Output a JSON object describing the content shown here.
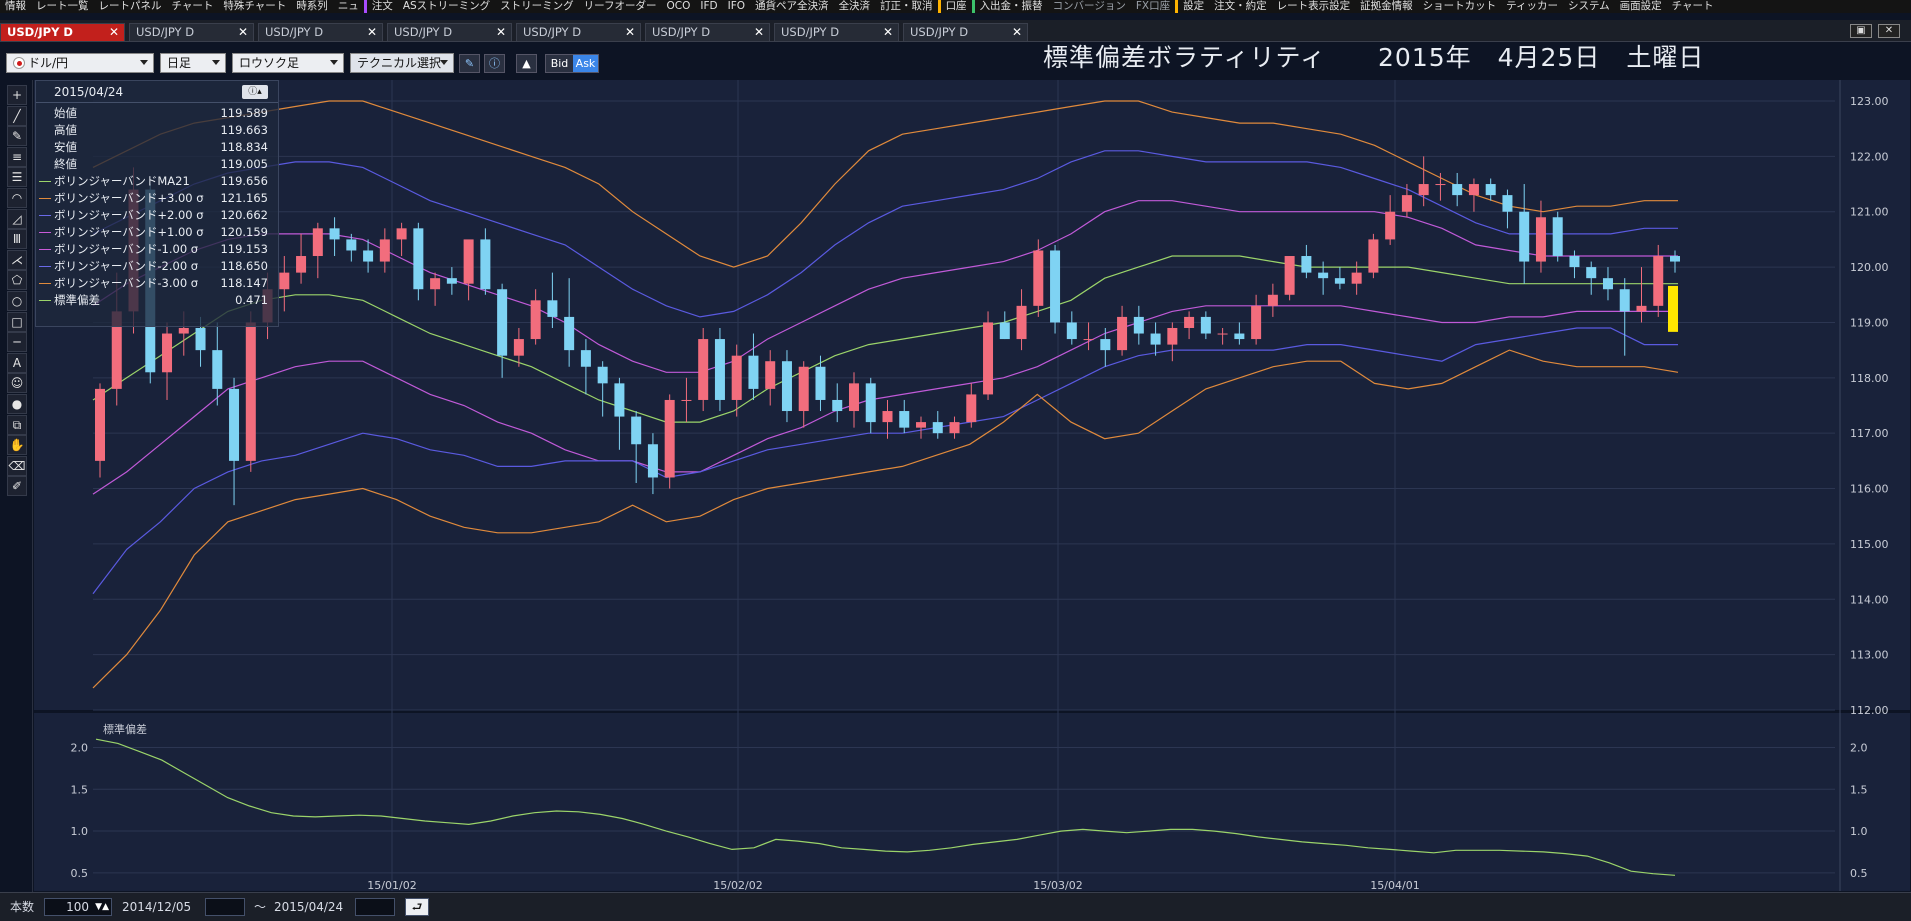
{
  "menubar": {
    "items": [
      "情報",
      "レート一覧",
      "レートパネル",
      "チャート",
      "特殊チャート",
      "時系列",
      "ニュ",
      "注文",
      "ASストリーミング",
      "ストリーミング",
      "リーフオーダー",
      "OCO",
      "IFD",
      "IFO",
      "通貨ペア全決済",
      "全決済",
      "訂正・取消",
      "口座",
      "入出金・振替",
      "コンバージョン",
      "FX口座",
      "設定",
      "注文・約定",
      "レート表示設定",
      "証拠金情報",
      "ショートカット",
      "ティッカー",
      "システム",
      "画面設定",
      "チャート"
    ]
  },
  "tabs": [
    {
      "label": "USD/JPY D",
      "active": true
    },
    {
      "label": "USD/JPY D",
      "active": false
    },
    {
      "label": "USD/JPY D",
      "active": false
    },
    {
      "label": "USD/JPY D",
      "active": false
    },
    {
      "label": "USD/JPY D",
      "active": false
    },
    {
      "label": "USD/JPY D",
      "active": false
    },
    {
      "label": "USD/JPY D",
      "active": false
    },
    {
      "label": "USD/JPY D",
      "active": false
    }
  ],
  "toolbar": {
    "pair": "ドル/円",
    "period": "日足",
    "chart_type": "ロウソク足",
    "technical": "テクニカル選択",
    "bid": "Bid",
    "ask": "Ask"
  },
  "title": "標準偏差ボラティリティ　　2015年　4月25日　土曜日",
  "info": {
    "date": "2015/04/24",
    "rows": [
      {
        "label": "始値",
        "value": "119.589",
        "color": ""
      },
      {
        "label": "高値",
        "value": "119.663",
        "color": ""
      },
      {
        "label": "安値",
        "value": "118.834",
        "color": ""
      },
      {
        "label": "終値",
        "value": "119.005",
        "color": ""
      },
      {
        "label": "ボリンジャーバンドMA21",
        "value": "119.656",
        "color": "#9bd46a"
      },
      {
        "label": "ボリンジャーバンド+3.00 σ",
        "value": "121.165",
        "color": "#e08a3c"
      },
      {
        "label": "ボリンジャーバンド+2.00 σ",
        "value": "120.662",
        "color": "#6a6ae8"
      },
      {
        "label": "ボリンジャーバンド+1.00 σ",
        "value": "120.159",
        "color": "#c85ad8"
      },
      {
        "label": "ボリンジャーバンド-1.00 σ",
        "value": "119.153",
        "color": "#c85ad8"
      },
      {
        "label": "ボリンジャーバンド-2.00 σ",
        "value": "118.650",
        "color": "#6a6ae8"
      },
      {
        "label": "ボリンジャーバンド-3.00 σ",
        "value": "118.147",
        "color": "#e08a3c"
      },
      {
        "label": "標準偏差",
        "value": "0.471",
        "color": "#9bd46a"
      }
    ]
  },
  "footer": {
    "count_label": "本数",
    "count": "100",
    "from_date": "2014/12/05",
    "tilde": "〜",
    "to_date": "2015/04/24"
  },
  "chart_data": [
    {
      "type": "candlestick",
      "title": "",
      "y_ticks": [
        "123.00",
        "122.00",
        "121.00",
        "120.00",
        "119.00",
        "118.00",
        "117.00",
        "116.00",
        "115.00",
        "114.00",
        "113.00",
        "112.00"
      ],
      "ylim": [
        112.0,
        123.0
      ],
      "x_tick_labels": [
        "15/01/02",
        "15/02/02",
        "15/03/02",
        "15/04/01"
      ],
      "candles": [
        [
          116.5,
          117.9,
          116.2,
          117.8
        ],
        [
          117.8,
          119.9,
          117.5,
          119.2
        ],
        [
          119.2,
          121.8,
          118.8,
          121.4
        ],
        [
          121.4,
          121.5,
          117.9,
          118.1
        ],
        [
          118.1,
          119.0,
          117.6,
          118.8
        ],
        [
          118.8,
          119.2,
          118.4,
          118.9
        ],
        [
          118.9,
          119.1,
          118.2,
          118.5
        ],
        [
          118.5,
          119.0,
          117.5,
          117.8
        ],
        [
          117.8,
          118.0,
          115.7,
          116.5
        ],
        [
          116.5,
          119.2,
          116.3,
          119.0
        ],
        [
          119.0,
          119.9,
          118.7,
          119.6
        ],
        [
          119.6,
          120.2,
          119.2,
          119.9
        ],
        [
          119.9,
          120.6,
          119.7,
          120.2
        ],
        [
          120.2,
          120.8,
          119.8,
          120.7
        ],
        [
          120.7,
          120.9,
          120.2,
          120.5
        ],
        [
          120.5,
          120.6,
          120.1,
          120.3
        ],
        [
          120.3,
          120.5,
          119.9,
          120.1
        ],
        [
          120.1,
          120.7,
          119.9,
          120.5
        ],
        [
          120.5,
          120.8,
          120.2,
          120.7
        ],
        [
          120.7,
          120.8,
          119.4,
          119.6
        ],
        [
          119.6,
          119.9,
          119.3,
          119.8
        ],
        [
          119.8,
          120.0,
          119.5,
          119.7
        ],
        [
          119.7,
          120.3,
          119.4,
          120.5
        ],
        [
          120.5,
          120.7,
          119.5,
          119.6
        ],
        [
          119.6,
          119.7,
          118.0,
          118.4
        ],
        [
          118.4,
          118.9,
          118.2,
          118.7
        ],
        [
          118.7,
          119.6,
          118.6,
          119.4
        ],
        [
          119.4,
          119.9,
          118.9,
          119.1
        ],
        [
          119.1,
          119.8,
          118.2,
          118.5
        ],
        [
          118.5,
          118.7,
          117.7,
          118.2
        ],
        [
          118.2,
          118.3,
          117.3,
          117.9
        ],
        [
          117.9,
          118.0,
          116.7,
          117.3
        ],
        [
          117.3,
          117.4,
          116.1,
          116.8
        ],
        [
          116.8,
          117.0,
          115.9,
          116.2
        ],
        [
          116.2,
          117.7,
          116.0,
          117.6
        ],
        [
          117.6,
          118.0,
          117.2,
          117.6
        ],
        [
          117.6,
          118.9,
          117.4,
          118.7
        ],
        [
          118.7,
          118.9,
          117.4,
          117.6
        ],
        [
          117.6,
          118.6,
          117.3,
          118.4
        ],
        [
          118.4,
          118.8,
          117.6,
          117.8
        ],
        [
          117.8,
          118.5,
          117.5,
          118.3
        ],
        [
          118.3,
          118.5,
          117.2,
          117.4
        ],
        [
          117.4,
          118.3,
          117.1,
          118.2
        ],
        [
          118.2,
          118.4,
          117.4,
          117.6
        ],
        [
          117.6,
          117.9,
          117.2,
          117.4
        ],
        [
          117.4,
          118.1,
          117.1,
          117.9
        ],
        [
          117.9,
          118.0,
          117.0,
          117.2
        ],
        [
          117.2,
          117.6,
          116.9,
          117.4
        ],
        [
          117.4,
          117.6,
          117.0,
          117.1
        ],
        [
          117.1,
          117.3,
          116.9,
          117.2
        ],
        [
          117.2,
          117.4,
          116.9,
          117.0
        ],
        [
          117.0,
          117.3,
          116.9,
          117.2
        ],
        [
          117.2,
          117.9,
          117.1,
          117.7
        ],
        [
          117.7,
          119.2,
          117.6,
          119.0
        ],
        [
          119.0,
          119.2,
          118.7,
          118.7
        ],
        [
          118.7,
          119.6,
          118.5,
          119.3
        ],
        [
          119.3,
          120.5,
          119.1,
          120.3
        ],
        [
          120.3,
          120.4,
          118.8,
          119.0
        ],
        [
          119.0,
          119.2,
          118.6,
          118.7
        ],
        [
          118.7,
          119.0,
          118.5,
          118.7
        ],
        [
          118.7,
          118.9,
          118.2,
          118.5
        ],
        [
          118.5,
          119.3,
          118.4,
          119.1
        ],
        [
          119.1,
          119.3,
          118.6,
          118.8
        ],
        [
          118.8,
          119.0,
          118.4,
          118.6
        ],
        [
          118.6,
          119.0,
          118.3,
          118.9
        ],
        [
          118.9,
          119.2,
          118.7,
          119.1
        ],
        [
          119.1,
          119.2,
          118.7,
          118.8
        ],
        [
          118.8,
          118.9,
          118.6,
          118.8
        ],
        [
          118.8,
          119.0,
          118.6,
          118.7
        ],
        [
          118.7,
          119.5,
          118.6,
          119.3
        ],
        [
          119.3,
          119.7,
          119.1,
          119.5
        ],
        [
          119.5,
          120.2,
          119.4,
          120.2
        ],
        [
          120.2,
          120.4,
          119.8,
          119.9
        ],
        [
          119.9,
          120.1,
          119.5,
          119.8
        ],
        [
          119.8,
          120.0,
          119.6,
          119.7
        ],
        [
          119.7,
          120.1,
          119.5,
          119.9
        ],
        [
          119.9,
          120.6,
          119.8,
          120.5
        ],
        [
          120.5,
          121.3,
          120.4,
          121.0
        ],
        [
          121.0,
          121.5,
          120.9,
          121.3
        ],
        [
          121.3,
          122.0,
          121.1,
          121.5
        ],
        [
          121.5,
          121.7,
          121.2,
          121.5
        ],
        [
          121.5,
          121.7,
          121.1,
          121.3
        ],
        [
          121.3,
          121.6,
          121.0,
          121.5
        ],
        [
          121.5,
          121.6,
          121.2,
          121.3
        ],
        [
          121.3,
          121.4,
          120.7,
          121.0
        ],
        [
          121.0,
          121.5,
          119.7,
          120.1
        ],
        [
          120.1,
          121.2,
          119.9,
          120.9
        ],
        [
          120.9,
          121.0,
          120.1,
          120.2
        ],
        [
          120.2,
          120.3,
          119.8,
          120.0
        ],
        [
          120.0,
          120.1,
          119.5,
          119.8
        ],
        [
          119.8,
          120.0,
          119.4,
          119.6
        ],
        [
          119.6,
          119.8,
          118.4,
          119.2
        ],
        [
          119.2,
          120.0,
          119.0,
          119.3
        ],
        [
          119.3,
          120.4,
          119.1,
          120.2
        ],
        [
          120.2,
          120.3,
          119.9,
          120.1
        ]
      ],
      "bands": {
        "upper3": [
          121.8,
          122.1,
          122.4,
          122.6,
          122.7,
          122.8,
          122.9,
          123.0,
          123.0,
          122.8,
          122.6,
          122.4,
          122.2,
          122.0,
          121.8,
          121.5,
          121.0,
          120.6,
          120.2,
          120.0,
          120.2,
          120.8,
          121.5,
          122.1,
          122.4,
          122.5,
          122.6,
          122.7,
          122.8,
          122.9,
          123.0,
          123.0,
          122.8,
          122.7,
          122.6,
          122.6,
          122.5,
          122.4,
          122.2,
          121.9,
          121.6,
          121.3,
          121.1,
          121.0,
          121.1,
          121.1,
          121.2,
          121.2
        ],
        "upper2": [
          120.6,
          120.9,
          121.2,
          121.5,
          121.7,
          121.8,
          121.9,
          121.9,
          121.8,
          121.5,
          121.2,
          121.0,
          120.8,
          120.6,
          120.4,
          120.0,
          119.6,
          119.3,
          119.1,
          119.2,
          119.5,
          119.9,
          120.4,
          120.8,
          121.1,
          121.2,
          121.3,
          121.4,
          121.6,
          121.9,
          122.1,
          122.1,
          122.0,
          121.9,
          121.9,
          121.9,
          121.9,
          121.8,
          121.6,
          121.4,
          121.1,
          120.8,
          120.6,
          120.6,
          120.6,
          120.6,
          120.7,
          120.7
        ],
        "upper1": [
          119.3,
          119.7,
          120.0,
          120.3,
          120.5,
          120.6,
          120.6,
          120.6,
          120.5,
          120.2,
          119.9,
          119.7,
          119.5,
          119.3,
          119.0,
          118.6,
          118.3,
          118.1,
          118.1,
          118.3,
          118.7,
          119.0,
          119.3,
          119.6,
          119.8,
          119.9,
          120.0,
          120.1,
          120.3,
          120.6,
          121.0,
          121.2,
          121.2,
          121.1,
          121.0,
          121.0,
          121.0,
          121.0,
          121.0,
          120.9,
          120.7,
          120.4,
          120.3,
          120.2,
          120.2,
          120.2,
          120.2,
          120.2
        ],
        "ma": [
          117.6,
          118.0,
          118.4,
          118.8,
          119.2,
          119.4,
          119.5,
          119.5,
          119.4,
          119.1,
          118.8,
          118.6,
          118.4,
          118.2,
          117.9,
          117.6,
          117.4,
          117.2,
          117.2,
          117.4,
          117.8,
          118.1,
          118.4,
          118.6,
          118.7,
          118.8,
          118.9,
          119.0,
          119.2,
          119.4,
          119.8,
          120.0,
          120.2,
          120.2,
          120.2,
          120.1,
          120.0,
          120.0,
          120.0,
          120.0,
          119.9,
          119.8,
          119.7,
          119.7,
          119.7,
          119.7,
          119.7,
          119.7
        ],
        "lower1": [
          115.9,
          116.3,
          116.8,
          117.3,
          117.8,
          118.0,
          118.2,
          118.3,
          118.3,
          118.0,
          117.7,
          117.5,
          117.2,
          117.0,
          116.7,
          116.5,
          116.5,
          116.3,
          116.3,
          116.6,
          116.9,
          117.1,
          117.4,
          117.6,
          117.7,
          117.8,
          117.9,
          118.0,
          118.2,
          118.5,
          118.8,
          119.0,
          119.2,
          119.3,
          119.3,
          119.3,
          119.3,
          119.3,
          119.2,
          119.1,
          119.0,
          119.0,
          119.1,
          119.1,
          119.2,
          119.2,
          119.2,
          119.2
        ],
        "lower2": [
          114.1,
          114.9,
          115.4,
          116.0,
          116.3,
          116.5,
          116.6,
          116.8,
          117.0,
          116.9,
          116.7,
          116.6,
          116.4,
          116.4,
          116.5,
          116.5,
          116.5,
          116.2,
          116.3,
          116.5,
          116.7,
          116.8,
          116.9,
          117.0,
          117.0,
          117.1,
          117.2,
          117.3,
          117.6,
          117.9,
          118.2,
          118.4,
          118.5,
          118.5,
          118.5,
          118.5,
          118.6,
          118.6,
          118.5,
          118.4,
          118.3,
          118.6,
          118.7,
          118.8,
          118.9,
          118.9,
          118.6,
          118.6
        ],
        "lower3": [
          112.4,
          113.0,
          113.8,
          114.8,
          115.4,
          115.6,
          115.8,
          115.9,
          116.0,
          115.8,
          115.5,
          115.3,
          115.2,
          115.2,
          115.3,
          115.4,
          115.7,
          115.4,
          115.5,
          115.8,
          116.0,
          116.1,
          116.2,
          116.3,
          116.4,
          116.6,
          116.8,
          117.2,
          117.7,
          117.2,
          116.9,
          117.0,
          117.4,
          117.8,
          118.0,
          118.2,
          118.3,
          118.3,
          117.9,
          117.8,
          117.9,
          118.2,
          118.5,
          118.3,
          118.2,
          118.2,
          118.2,
          118.1
        ]
      }
    },
    {
      "type": "line",
      "title": "",
      "series_label": "標準偏差",
      "y_ticks": [
        "2.0",
        "1.5",
        "1.0",
        "0.5"
      ],
      "ylim": [
        0.45,
        2.15
      ],
      "values": [
        2.1,
        2.05,
        1.95,
        1.85,
        1.7,
        1.55,
        1.4,
        1.3,
        1.22,
        1.18,
        1.17,
        1.18,
        1.19,
        1.18,
        1.15,
        1.12,
        1.1,
        1.08,
        1.12,
        1.18,
        1.22,
        1.24,
        1.23,
        1.2,
        1.15,
        1.08,
        1.0,
        0.93,
        0.85,
        0.78,
        0.8,
        0.9,
        0.88,
        0.85,
        0.8,
        0.78,
        0.76,
        0.75,
        0.77,
        0.8,
        0.84,
        0.87,
        0.9,
        0.95,
        1.0,
        1.02,
        1.0,
        0.98,
        1.0,
        1.02,
        1.02,
        1.0,
        0.97,
        0.93,
        0.9,
        0.87,
        0.85,
        0.83,
        0.8,
        0.78,
        0.76,
        0.74,
        0.77,
        0.77,
        0.77,
        0.76,
        0.75,
        0.73,
        0.7,
        0.62,
        0.52,
        0.49,
        0.47
      ]
    }
  ]
}
